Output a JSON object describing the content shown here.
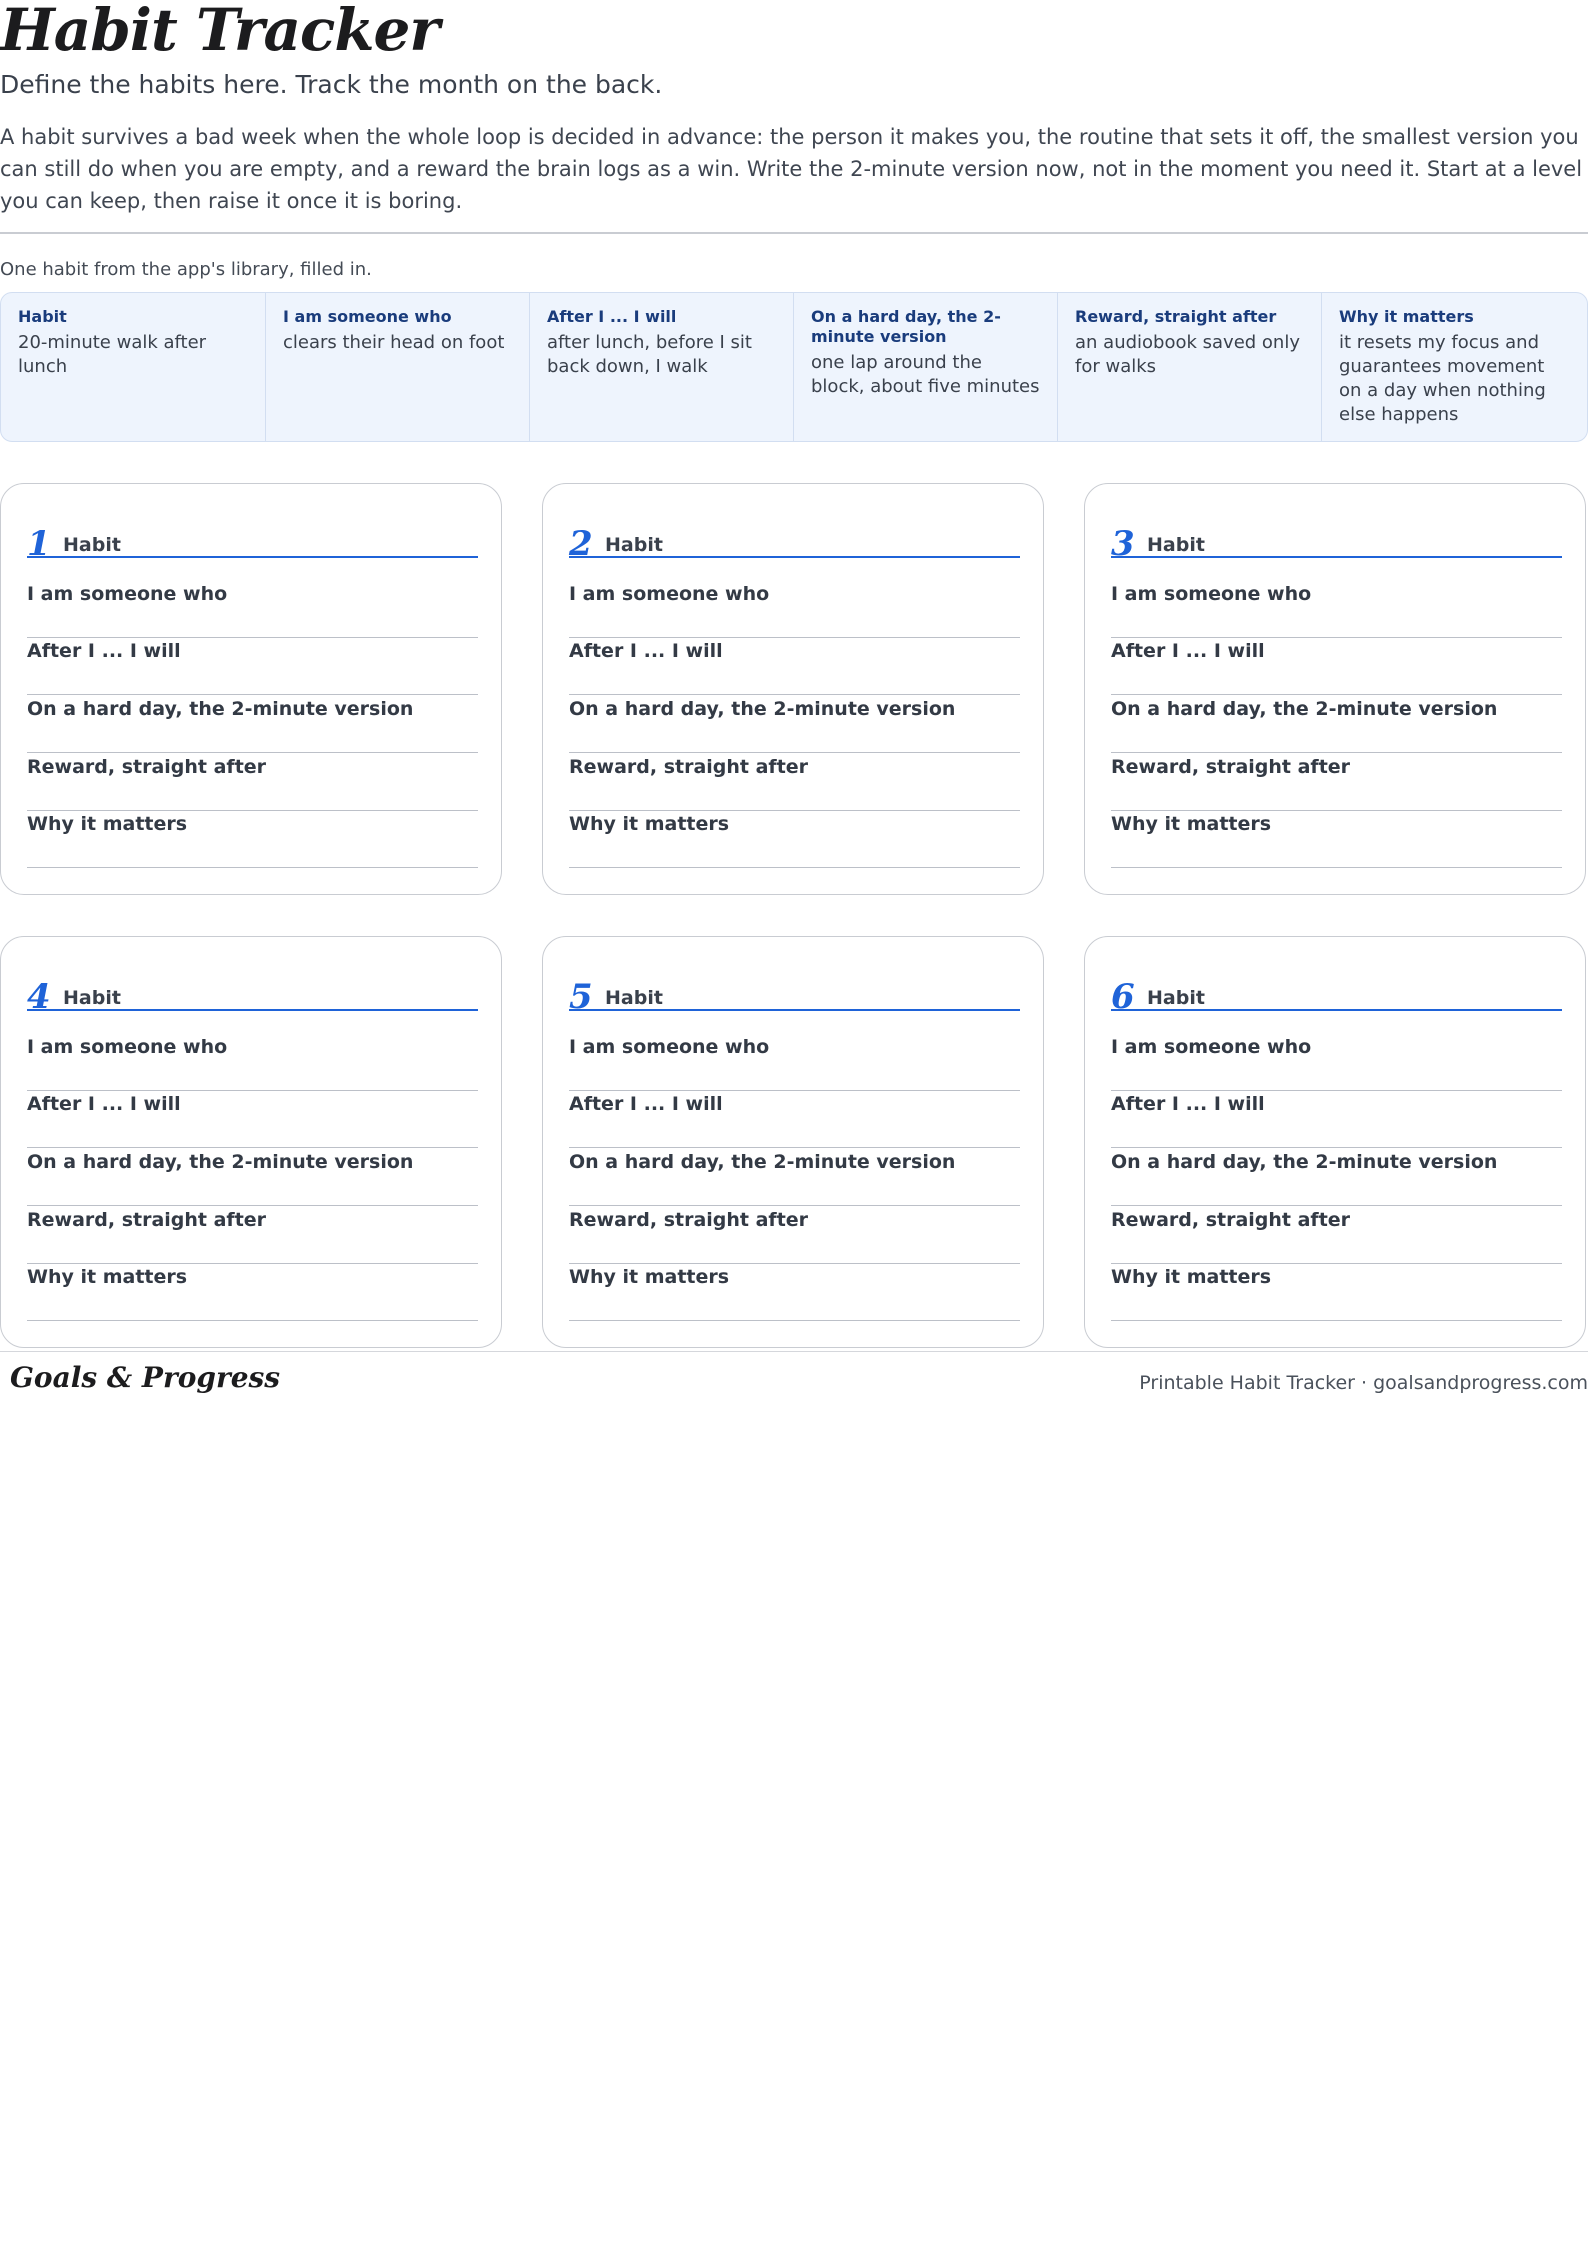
{
  "header": {
    "title": "Habit Tracker",
    "subtitle": "Define the habits here. Track the month on the back.",
    "intro": "A habit survives a bad week when the whole loop is decided in advance: the person it makes you, the routine that sets it off, the smallest version you can still do when you are empty, and a reward the brain logs as a win. Write the 2-minute version now, not in the moment you need it. Start at a level you can keep, then raise it once it is boring."
  },
  "example": {
    "note": "One habit from the app's library, filled in.",
    "cells": [
      {
        "label": "Habit",
        "value": "20-minute walk after lunch"
      },
      {
        "label": "I am someone who",
        "value": "clears their head on foot"
      },
      {
        "label": "After I ... I will",
        "value": "after lunch, before I sit back down, I walk"
      },
      {
        "label": "On a hard day, the 2-minute version",
        "value": "one lap around the block, about five minutes"
      },
      {
        "label": "Reward, straight after",
        "value": "an audiobook saved only for walks"
      },
      {
        "label": "Why it matters",
        "value": "it resets my focus and guarantees movement on a day when nothing else happens"
      }
    ]
  },
  "card_fields": {
    "habit": "Habit",
    "identity": "I am someone who",
    "cue": "After I ... I will",
    "minimum": "On a hard day, the 2-minute version",
    "reward": "Reward, straight after",
    "why": "Why it matters"
  },
  "cards": [
    {
      "number": "1"
    },
    {
      "number": "2"
    },
    {
      "number": "3"
    },
    {
      "number": "4"
    },
    {
      "number": "5"
    },
    {
      "number": "6"
    }
  ],
  "footer": {
    "brand": "Goals & Progress",
    "text": "Printable Habit Tracker · goalsandprogress.com"
  }
}
